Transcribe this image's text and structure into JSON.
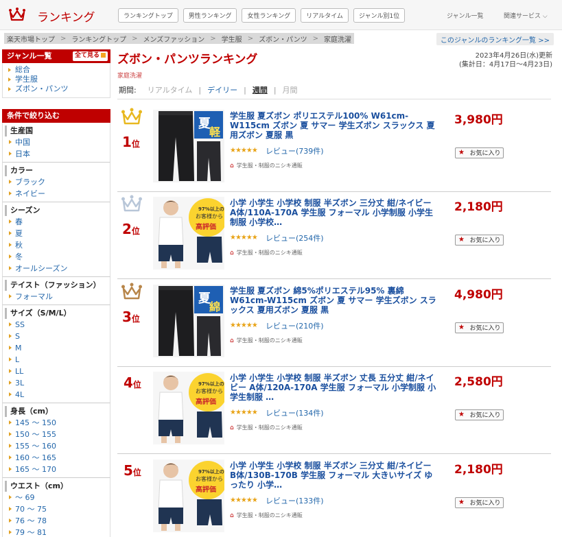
{
  "header": {
    "logo_text": "ランキング",
    "tabs": [
      "ランキングトップ",
      "男性ランキング",
      "女性ランキング",
      "リアルタイム",
      "ジャンル別1位"
    ],
    "genre_list": "ジャンル一覧",
    "related_services": "関連サービス ⌵"
  },
  "breadcrumb": [
    "楽天市場トップ",
    "ランキングトップ",
    "メンズファッション",
    "学生服",
    "ズボン・パンツ",
    "家庭洗濯"
  ],
  "genre_ranking_list_link": "このジャンルのランキング一覧 >>",
  "sidebar": {
    "genre_header": "ジャンル一覧",
    "see_all": "全て見る",
    "genres": [
      "総合",
      "学生服",
      "ズボン・パンツ"
    ],
    "filter_header": "条件で絞り込む",
    "filters": [
      {
        "title": "生産国",
        "items": [
          "中国",
          "日本"
        ]
      },
      {
        "title": "カラー",
        "items": [
          "ブラック",
          "ネイビー"
        ]
      },
      {
        "title": "シーズン",
        "items": [
          "春",
          "夏",
          "秋",
          "冬",
          "オールシーズン"
        ]
      },
      {
        "title": "テイスト（ファッション）",
        "items": [
          "フォーマル"
        ]
      },
      {
        "title": "サイズ（S/M/L）",
        "items": [
          "SS",
          "S",
          "M",
          "L",
          "LL",
          "3L",
          "4L"
        ]
      },
      {
        "title": "身長（cm）",
        "items": [
          "145 ～ 150",
          "150 ～ 155",
          "155 ～ 160",
          "160 ～ 165",
          "165 ～ 170"
        ]
      },
      {
        "title": "ウエスト（cm）",
        "items": [
          "～ 69",
          "70 ～ 75",
          "76 ～ 78",
          "79 ～ 81"
        ]
      }
    ]
  },
  "main": {
    "title": "ズボン・パンツランキング",
    "subgenre": "家庭洗濯",
    "updated": "2023年4月26日(水)更新",
    "period_range": "(集計日：4月17日～4月23日)",
    "period_label": "期間:",
    "periods": [
      "リアルタイム",
      "デイリー",
      "週間",
      "月間"
    ]
  },
  "items": [
    {
      "rank": "1",
      "rank_suffix": "位",
      "title": "学生服 夏ズボン ポリエステル100% W61cm-W115cm ズボン 夏 サマー 学生ズボン スラックス 夏用ズボン 夏服 黒",
      "stars": "★★★★★",
      "rating": 4.5,
      "review": "レビュー(739件)",
      "shop": "学生服・制服のニシキ通販",
      "price": "3,980円",
      "fav": "お気に入り",
      "crown_color": "#e8b820"
    },
    {
      "rank": "2",
      "rank_suffix": "位",
      "title": "小学 小学生 小学校 制服 半ズボン 三分丈 紺/ネイビー A体/110A-170A 学生服 フォーマル 小学制服 小学生制服 小学校…",
      "stars": "★★★★★",
      "rating": 4.5,
      "review": "レビュー(254件)",
      "shop": "学生服・制服のニシキ通販",
      "price": "2,180円",
      "fav": "お気に入り",
      "crown_color": "#b8c6d8"
    },
    {
      "rank": "3",
      "rank_suffix": "位",
      "title": "学生服 夏ズボン 綿5%ポリエステル95% 裏綿 W61cm-W115cm ズボン 夏 サマー 学生ズボン スラックス 夏用ズボン 夏服 黒",
      "stars": "★★★★★",
      "rating": 4.5,
      "review": "レビュー(210件)",
      "shop": "学生服・制服のニシキ通販",
      "price": "4,980円",
      "fav": "お気に入り",
      "crown_color": "#b8864a"
    },
    {
      "rank": "4",
      "rank_suffix": "位",
      "title": "小学 小学生 小学校 制服 半ズボン 丈長 五分丈 紺/ネイビー A体/120A-170A 学生服 フォーマル 小学制服 小学生制服 …",
      "stars": "★★★★★",
      "rating": 4.5,
      "review": "レビュー(134件)",
      "shop": "学生服・制服のニシキ通販",
      "price": "2,580円",
      "fav": "お気に入り",
      "crown_color": ""
    },
    {
      "rank": "5",
      "rank_suffix": "位",
      "title": "小学 小学生 小学校 制服 半ズボン 三分丈 紺/ネイビー B体/130B-170B 学生服 フォーマル 大きいサイズ ゆったり 小学…",
      "stars": "★★★★★",
      "rating": 4.5,
      "review": "レビュー(133件)",
      "shop": "学生服・制服のニシキ通販",
      "price": "2,180円",
      "fav": "お気に入り",
      "crown_color": ""
    }
  ],
  "thumb_texts": {
    "summer": "夏",
    "light": "軽",
    "cotton": "綿",
    "percent": "97%以上の",
    "from_customers": "お客様から",
    "high_rating": "高評価"
  }
}
